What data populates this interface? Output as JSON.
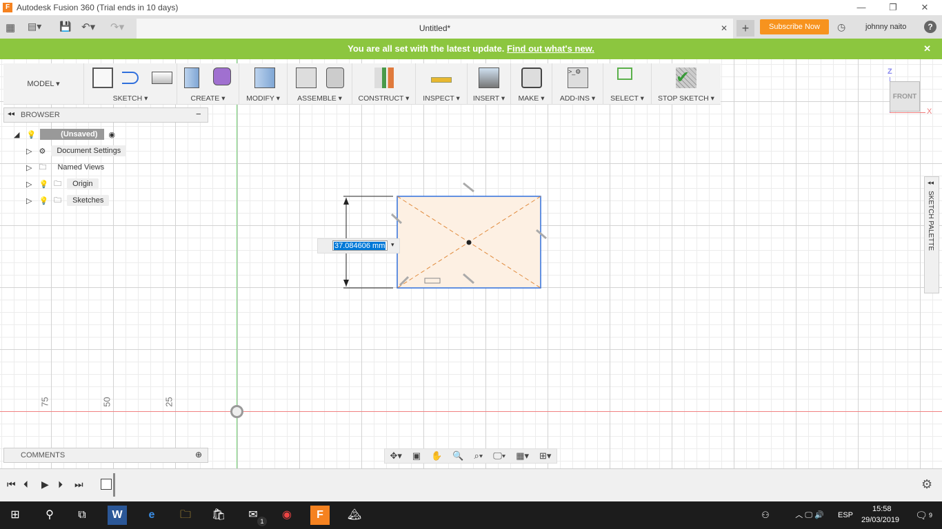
{
  "window": {
    "title": "Autodesk Fusion 360 (Trial ends in 10 days)",
    "minimize": "—",
    "restore": "❐",
    "close": "✕"
  },
  "quickbar": {
    "doc_tab": "Untitled*",
    "subscribe": "Subscribe Now",
    "user": "johnny naito",
    "help": "?",
    "close_tab": "✕",
    "new_tab": "+"
  },
  "banner": {
    "text": "You are all set with the latest update.",
    "link": "Find out what's new.",
    "close": "✕"
  },
  "toolbar": {
    "workspace": "MODEL ▾",
    "groups": [
      "SKETCH ▾",
      "CREATE ▾",
      "MODIFY ▾",
      "ASSEMBLE ▾",
      "CONSTRUCT ▾",
      "INSPECT ▾",
      "INSERT ▾",
      "MAKE ▾",
      "ADD-INS ▾",
      "SELECT ▾",
      "STOP SKETCH ▾"
    ]
  },
  "browser": {
    "title": "BROWSER",
    "root": "(Unsaved)",
    "items": [
      "Document Settings",
      "Named Views",
      "Origin",
      "Sketches"
    ]
  },
  "comments": {
    "title": "COMMENTS"
  },
  "viewcube": {
    "face": "FRONT",
    "z": "Z",
    "x": "X"
  },
  "sketch_palette": {
    "title": "SKETCH PALETTE"
  },
  "canvas": {
    "dimension_value": "37.084606 mm",
    "axis_labels": [
      "75",
      "50",
      "25"
    ]
  },
  "taskbar": {
    "lang": "ESP",
    "time": "15:58",
    "date": "29/03/2019",
    "notifications": "9",
    "mail_badge": "1"
  },
  "colors": {
    "banner": "#8cc63f",
    "subscribe": "#f7931e",
    "sketch_fill": "#fdf0e3",
    "sketch_line": "#e08a3c",
    "selection": "#0078d7"
  }
}
